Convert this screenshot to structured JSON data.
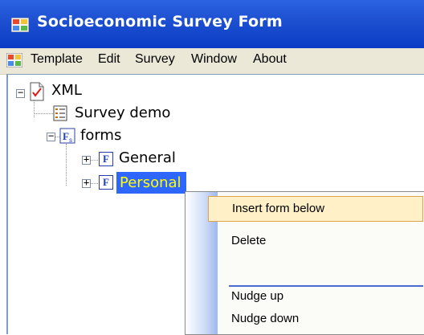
{
  "window": {
    "title": "Socioeconomic Survey Form"
  },
  "menubar": {
    "items": [
      "Template",
      "Edit",
      "Survey",
      "Window",
      "About"
    ]
  },
  "tree": {
    "root": "XML",
    "survey": "Survey demo",
    "forms": "forms",
    "form_general": "General",
    "form_personal": "Personal",
    "expander_collapse": "−",
    "expander_expand": "+",
    "form_icon_letter": "F"
  },
  "context_menu": {
    "items": [
      "Insert form below",
      "Delete",
      "Nudge up",
      "Nudge down"
    ]
  }
}
